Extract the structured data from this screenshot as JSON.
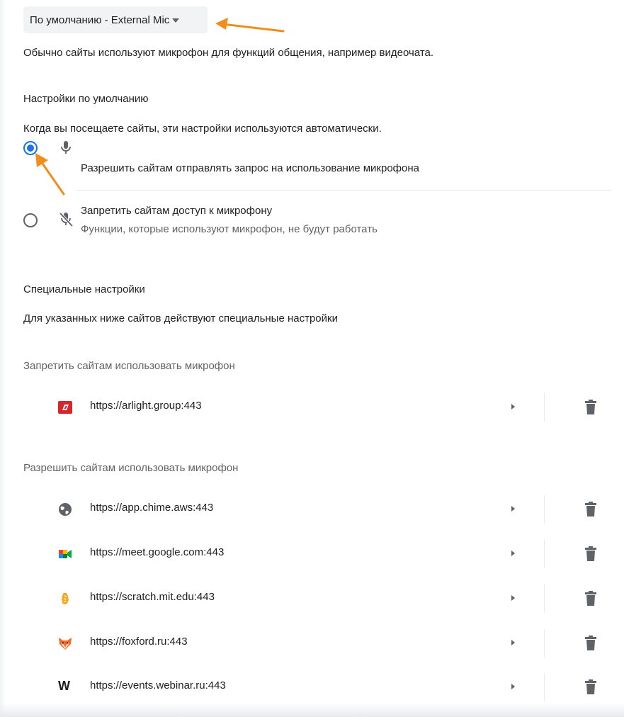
{
  "microphone_select": {
    "selected": "По умолчанию - External Mic"
  },
  "description": "Обычно сайты используют микрофон для функций общения, например видеочата.",
  "default_settings": {
    "heading": "Настройки по умолчанию",
    "subtitle": "Когда вы посещаете сайты, эти настройки используются автоматически.",
    "options": [
      {
        "label": "Разрешить сайтам отправлять запрос на использование микрофона",
        "sublabel": "",
        "checked": true,
        "icon": "mic-icon"
      },
      {
        "label": "Запретить сайтам доступ к микрофону",
        "sublabel": "Функции, которые используют микрофон, не будут работать",
        "checked": false,
        "icon": "mic-off-icon"
      }
    ]
  },
  "custom_settings": {
    "heading": "Специальные настройки",
    "subtitle": "Для указанных ниже сайтов действуют специальные настройки"
  },
  "blocked": {
    "heading": "Запретить сайтам использовать микрофон",
    "sites": [
      {
        "url": "https://arlight.group:443",
        "icon": "arlight-favicon-icon"
      }
    ]
  },
  "allowed": {
    "heading": "Разрешить сайтам использовать микрофон",
    "sites": [
      {
        "url": "https://app.chime.aws:443",
        "icon": "globe-icon"
      },
      {
        "url": "https://meet.google.com:443",
        "icon": "google-meet-icon"
      },
      {
        "url": "https://scratch.mit.edu:443",
        "icon": "scratch-icon"
      },
      {
        "url": "https://foxford.ru:443",
        "icon": "foxford-icon"
      },
      {
        "url": "https://events.webinar.ru:443",
        "icon": "webinar-w-icon"
      }
    ]
  },
  "colors": {
    "accent": "#1a73e8",
    "annotation_arrow": "#f28c1b",
    "text_primary": "#202124",
    "text_secondary": "#5f6368"
  },
  "webinar_letter": "W"
}
